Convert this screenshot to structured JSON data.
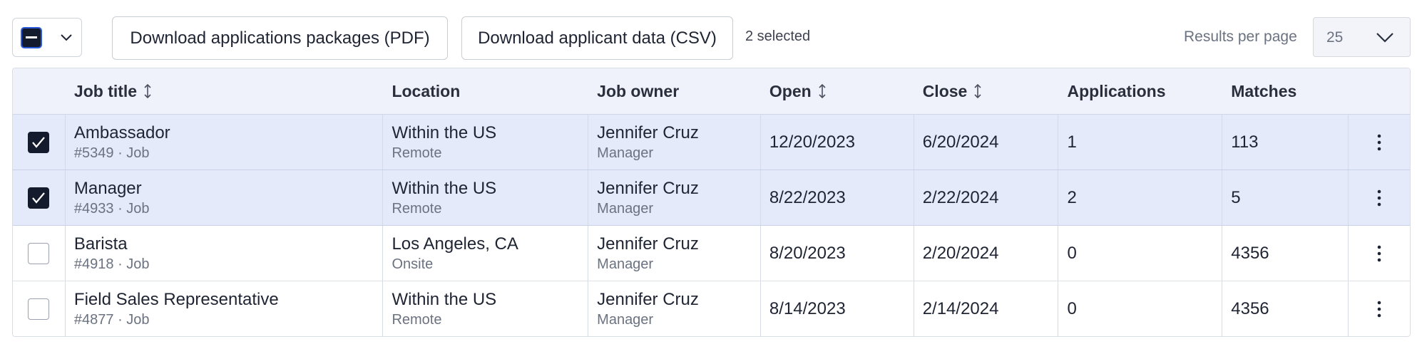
{
  "toolbar": {
    "download_pdf_label": "Download applications packages (PDF)",
    "download_csv_label": "Download applicant data (CSV)",
    "selected_count": "2 selected",
    "results_per_page_label": "Results per page",
    "results_per_page_value": "25"
  },
  "table": {
    "headers": {
      "job_title": "Job title",
      "location": "Location",
      "job_owner": "Job owner",
      "open": "Open",
      "close": "Close",
      "applications": "Applications",
      "matches": "Matches"
    },
    "rows": [
      {
        "selected": true,
        "title": "Ambassador",
        "meta": "#5349 · Job",
        "location": "Within the US",
        "location_type": "Remote",
        "owner": "Jennifer Cruz",
        "owner_role": "Manager",
        "open": "12/20/2023",
        "close": "6/20/2024",
        "applications": "1",
        "matches": "113"
      },
      {
        "selected": true,
        "title": "Manager",
        "meta": "#4933 · Job",
        "location": "Within the US",
        "location_type": "Remote",
        "owner": "Jennifer Cruz",
        "owner_role": "Manager",
        "open": "8/22/2023",
        "close": "2/22/2024",
        "applications": "2",
        "matches": "5"
      },
      {
        "selected": false,
        "title": "Barista",
        "meta": "#4918 · Job",
        "location": "Los Angeles, CA",
        "location_type": "Onsite",
        "owner": "Jennifer Cruz",
        "owner_role": "Manager",
        "open": "8/20/2023",
        "close": "2/20/2024",
        "applications": "0",
        "matches": "4356"
      },
      {
        "selected": false,
        "title": "Field Sales Representative",
        "meta": "#4877 · Job",
        "location": "Within the US",
        "location_type": "Remote",
        "owner": "Jennifer Cruz",
        "owner_role": "Manager",
        "open": "8/14/2023",
        "close": "2/14/2024",
        "applications": "0",
        "matches": "4356"
      }
    ]
  },
  "colors": {
    "selected_row": "#e5eafb",
    "header_bg": "#eff2fb",
    "checkbox_checked": "#141b2c",
    "accent_outline": "#2c5bd9"
  },
  "icons": [
    "chevron-down-icon",
    "sort-icon",
    "checkmark-icon",
    "kebab-menu-icon"
  ]
}
